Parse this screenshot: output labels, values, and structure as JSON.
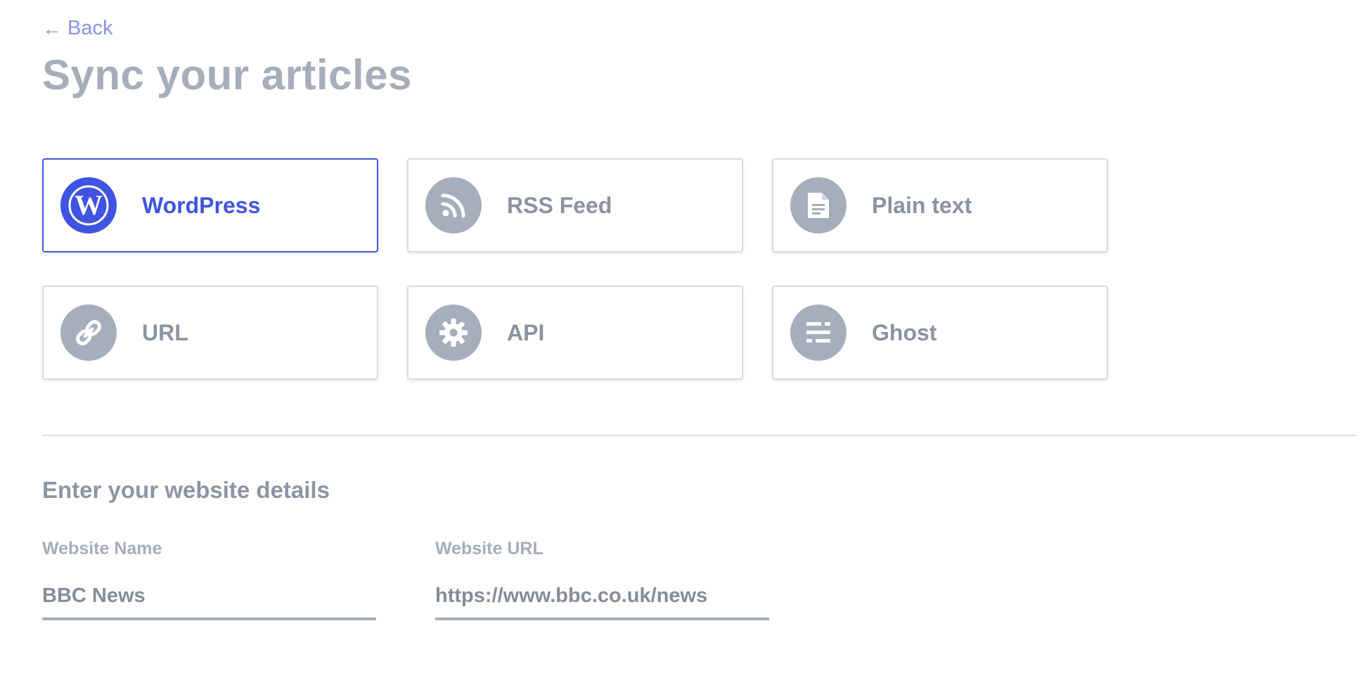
{
  "nav": {
    "back_label": "Back"
  },
  "page": {
    "title": "Sync your articles"
  },
  "sources": [
    {
      "label": "WordPress",
      "icon": "wordpress-icon",
      "selected": true
    },
    {
      "label": "RSS Feed",
      "icon": "rss-icon",
      "selected": false
    },
    {
      "label": "Plain text",
      "icon": "document-icon",
      "selected": false
    },
    {
      "label": "URL",
      "icon": "link-icon",
      "selected": false
    },
    {
      "label": "API",
      "icon": "gear-icon",
      "selected": false
    },
    {
      "label": "Ghost",
      "icon": "ghost-icon",
      "selected": false
    }
  ],
  "details": {
    "heading": "Enter your website details",
    "website_name": {
      "label": "Website Name",
      "value": "BBC News"
    },
    "website_url": {
      "label": "Website URL",
      "value": "https://www.bbc.co.uk/news"
    }
  },
  "colors": {
    "accent": "#3f55e1",
    "link": "#8a93e6",
    "muted": "#a5aebc",
    "text": "#8a93a2"
  }
}
